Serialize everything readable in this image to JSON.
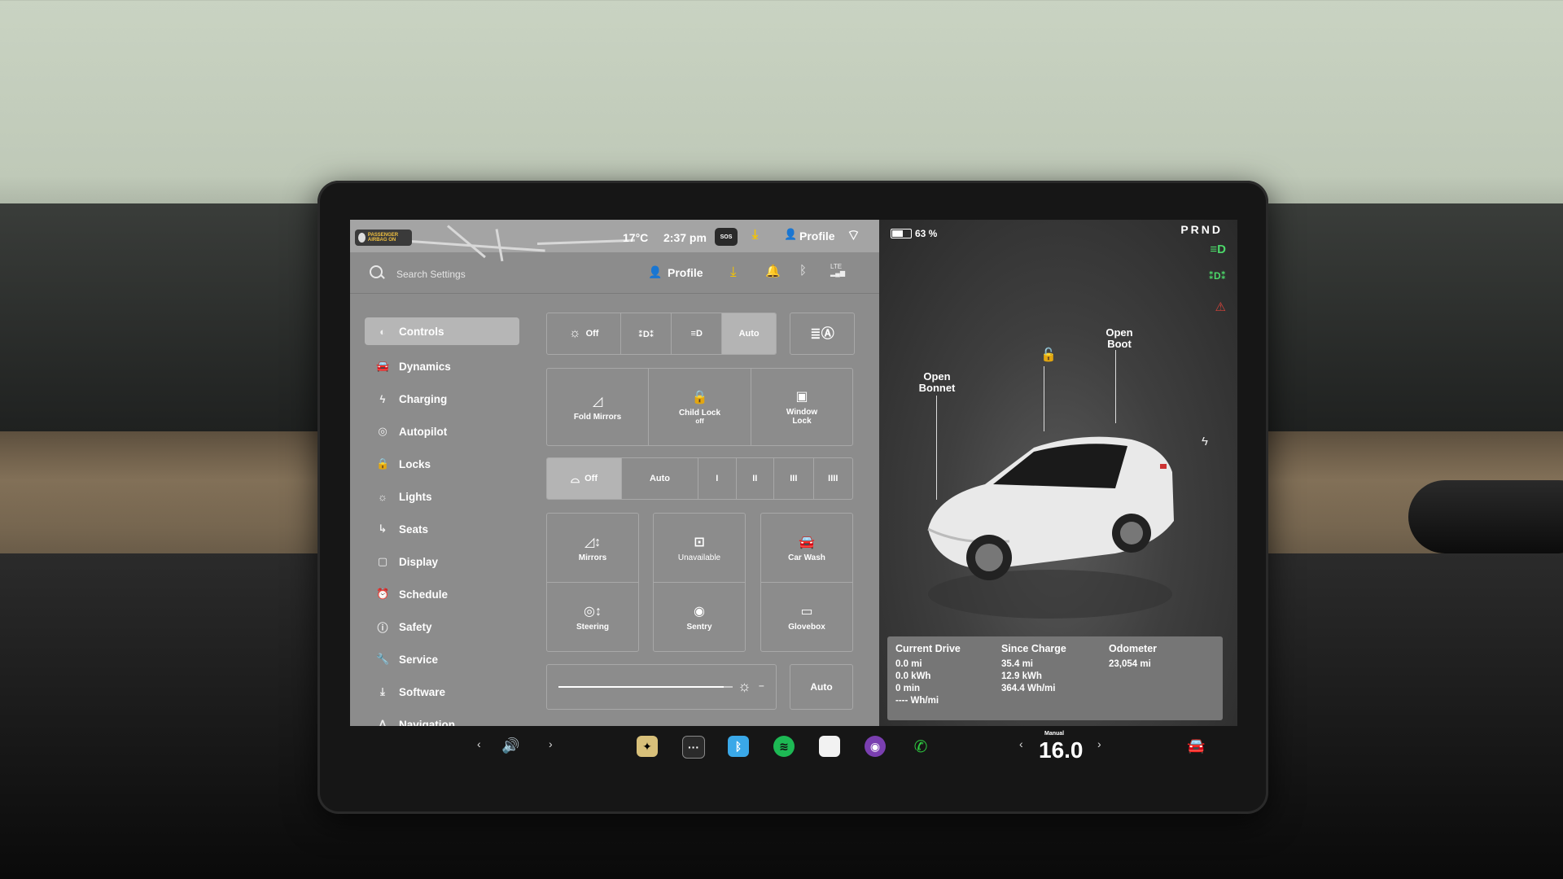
{
  "status_bar": {
    "airbag": "PASSENGER AIRBAG ON",
    "temperature": "17°C",
    "time": "2:37 pm",
    "sos": "SOS",
    "profile": "Profile"
  },
  "search": {
    "placeholder": "Search Settings"
  },
  "header": {
    "profile": "Profile",
    "lte": "LTE"
  },
  "nav": {
    "items": [
      {
        "label": "Controls",
        "icon": "toggle-icon",
        "glyph": "◐"
      },
      {
        "label": "Dynamics",
        "icon": "car-icon",
        "glyph": "🚘"
      },
      {
        "label": "Charging",
        "icon": "bolt-icon",
        "glyph": "ϟ"
      },
      {
        "label": "Autopilot",
        "icon": "steering-wheel-icon",
        "glyph": "◎"
      },
      {
        "label": "Locks",
        "icon": "lock-icon",
        "glyph": "🔒"
      },
      {
        "label": "Lights",
        "icon": "sun-icon",
        "glyph": "☼"
      },
      {
        "label": "Seats",
        "icon": "seat-icon",
        "glyph": "↳"
      },
      {
        "label": "Display",
        "icon": "display-icon",
        "glyph": "▢"
      },
      {
        "label": "Schedule",
        "icon": "alarm-icon",
        "glyph": "⏰"
      },
      {
        "label": "Safety",
        "icon": "info-icon",
        "glyph": "ⓘ"
      },
      {
        "label": "Service",
        "icon": "wrench-icon",
        "glyph": "🔧"
      },
      {
        "label": "Software",
        "icon": "download-icon",
        "glyph": "⤓"
      },
      {
        "label": "Navigation",
        "icon": "navigation-icon",
        "glyph": "⋀"
      }
    ]
  },
  "lights": {
    "off": "Off",
    "auto": "Auto"
  },
  "controls": {
    "fold_mirrors": "Fold Mirrors",
    "child_lock": "Child Lock",
    "child_lock_state": "off",
    "window_lock": "Window Lock"
  },
  "wipers": {
    "off": "Off",
    "auto": "Auto",
    "speeds": [
      "I",
      "II",
      "III",
      "IIII"
    ]
  },
  "tiles": {
    "mirrors": "Mirrors",
    "unavailable": "Unavailable",
    "car_wash": "Car Wash",
    "steering": "Steering",
    "sentry": "Sentry",
    "glovebox": "Glovebox"
  },
  "brightness": {
    "auto": "Auto",
    "level": 0.95
  },
  "car": {
    "battery": "63 %",
    "battery_level": 0.63,
    "gear": "PRND",
    "open_bonnet": "Open Bonnet",
    "open_boot": "Open Boot"
  },
  "trip": {
    "current_drive": {
      "title": "Current Drive",
      "lines": [
        "0.0 mi",
        "0.0 kWh",
        "0 min",
        "---- Wh/mi"
      ]
    },
    "since_charge": {
      "title": "Since Charge",
      "lines": [
        "35.4 mi",
        "12.9 kWh",
        "364.4 Wh/mi"
      ]
    },
    "odometer": {
      "title": "Odometer",
      "lines": [
        "23,054 mi"
      ]
    }
  },
  "climate": {
    "mode": "Manual",
    "temperature": "16.0"
  }
}
